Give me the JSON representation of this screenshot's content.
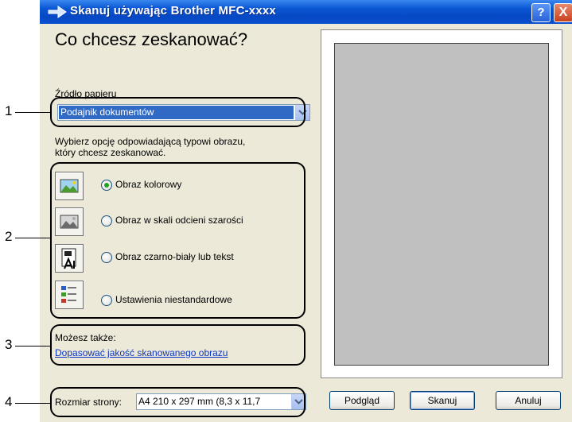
{
  "window": {
    "title": "Skanuj używając Brother MFC-xxxx",
    "help_label": "?",
    "close_label": "X",
    "arrow_icon": "arrow-right-icon"
  },
  "main": {
    "heading": "Co chcesz zeskanować?",
    "paper_source_label": "Źródło papieru",
    "paper_source_value": "Podajnik dokumentów",
    "instruction_line1": "Wybierz opcję odpowiadającą typowi obrazu,",
    "instruction_line2": "który chcesz zeskanować.",
    "options": [
      {
        "label": "Obraz kolorowy",
        "selected": true,
        "icon": "color-picture-icon"
      },
      {
        "label": "Obraz w skali odcieni szarości",
        "selected": false,
        "icon": "grayscale-picture-icon"
      },
      {
        "label": "Obraz czarno-biały lub tekst",
        "selected": false,
        "icon": "black-white-text-icon"
      },
      {
        "label": "Ustawienia niestandardowe",
        "selected": false,
        "icon": "custom-settings-icon"
      }
    ],
    "also_label": "Możesz także:",
    "adjust_link": "Dopasować jakość skanowanego obrazu"
  },
  "bottom": {
    "page_size_label": "Rozmiar strony:",
    "page_size_value": "A4 210 x 297 mm (8,3 x 11,7",
    "preview_button": "Podgląd",
    "scan_button": "Skanuj",
    "cancel_button": "Anuluj"
  },
  "callouts": [
    "1",
    "2",
    "3",
    "4"
  ],
  "colors": {
    "title_bar": "#0a57d4",
    "dialog_bg": "#ece9d8",
    "selection": "#316ac5",
    "link": "#0b35c6",
    "preview_area": "#c0c0c0"
  }
}
